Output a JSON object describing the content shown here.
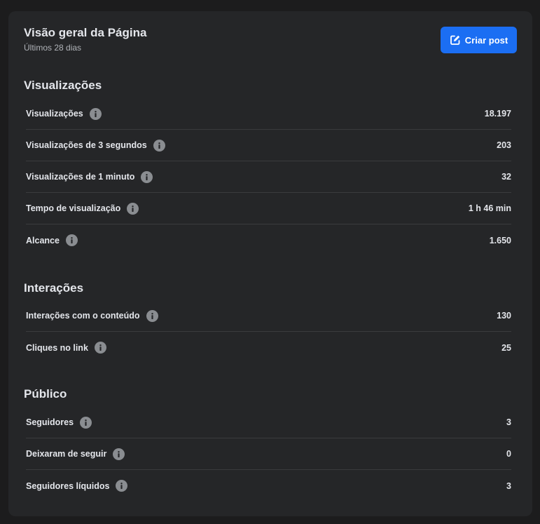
{
  "header": {
    "title": "Visão geral da Página",
    "subtitle": "Últimos 28 dias",
    "create_button_label": "Criar post"
  },
  "sections": [
    {
      "title": "Visualizações",
      "rows": [
        {
          "label": "Visualizações",
          "value": "18.197"
        },
        {
          "label": "Visualizações de 3 segundos",
          "value": "203"
        },
        {
          "label": "Visualizações de 1 minuto",
          "value": "32"
        },
        {
          "label": "Tempo de visualização",
          "value": "1 h 46 min"
        },
        {
          "label": "Alcance",
          "value": "1.650"
        }
      ]
    },
    {
      "title": "Interações",
      "rows": [
        {
          "label": "Interações com o conteúdo",
          "value": "130"
        },
        {
          "label": "Cliques no link",
          "value": "25"
        }
      ]
    },
    {
      "title": "Público",
      "rows": [
        {
          "label": "Seguidores",
          "value": "3"
        },
        {
          "label": "Deixaram de seguir",
          "value": "0"
        },
        {
          "label": "Seguidores líquidos",
          "value": "3"
        }
      ]
    }
  ],
  "colors": {
    "background": "#1c1c1d",
    "card": "#252628",
    "accent": "#1b6ef3",
    "text": "#e4e6eb",
    "muted": "#b0b3b8",
    "info_icon": "#8a8d91"
  },
  "icons": {
    "create_post": "edit-icon",
    "metric_info": "info-icon"
  }
}
